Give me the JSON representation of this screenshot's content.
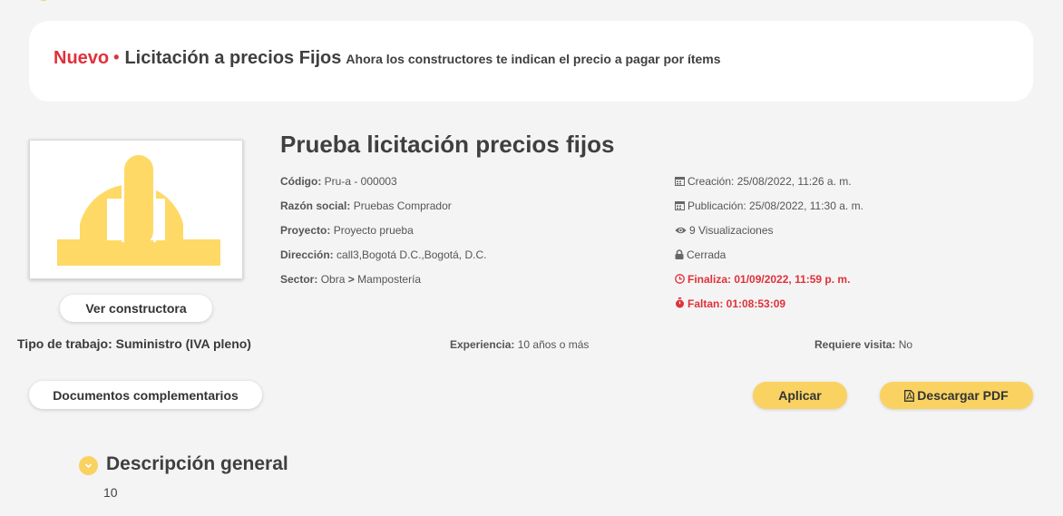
{
  "banner": {
    "new_label": "Nuevo",
    "separator": "•",
    "title": "Licitación a precios Fijos",
    "subtitle": "Ahora los constructores te indican el precio a pagar por ítems"
  },
  "project": {
    "title": "Prueba licitación precios fijos",
    "details": {
      "codigo_label": "Código:",
      "codigo_value": "Pru-a - 000003",
      "razon_label": "Razón social:",
      "razon_value": "Pruebas Comprador",
      "proyecto_label": "Proyecto:",
      "proyecto_value": "Proyecto prueba",
      "direccion_label": "Dirección:",
      "direccion_value": "call3,Bogotá D.C.,Bogotá, D.C.",
      "sector_label": "Sector:",
      "sector_value_1": "Obra",
      "sector_sep": ">",
      "sector_value_2": "Mampostería"
    },
    "meta": {
      "creacion": "Creación: 25/08/2022, 11:26 a. m.",
      "publicacion": "Publicación: 25/08/2022, 11:30 a. m.",
      "visualizaciones": "9 Visualizaciones",
      "estado": "Cerrada",
      "finaliza": "Finaliza: 01/09/2022, 11:59 p. m.",
      "faltan": "Faltan: 01:08:53:09"
    }
  },
  "buttons": {
    "ver_constructora": "Ver constructora",
    "documentos": "Documentos complementarios",
    "aplicar": "Aplicar",
    "descargar_pdf": "Descargar PDF"
  },
  "attributes": {
    "tipo_trabajo": "Tipo de trabajo: Suministro (IVA pleno)",
    "experiencia_label": "Experiencia:",
    "experiencia_value": "10 años o más",
    "visita_label": "Requiere visita:",
    "visita_value": "No"
  },
  "description": {
    "title": "Descripción general",
    "body": "10"
  },
  "colors": {
    "accent_yellow": "#f9d262",
    "alert_red": "#e0313a",
    "logo_yellow": "#ffd966"
  },
  "icons": {
    "creacion": "calendar-icon",
    "publicacion": "calendar-icon",
    "visualizaciones": "eye-icon",
    "estado": "lock-icon",
    "finaliza": "clock-icon",
    "faltan": "stopwatch-icon",
    "descargar": "pdf-file-icon",
    "section": "chevron-down-icon",
    "logo": "hard-hat-logo"
  }
}
